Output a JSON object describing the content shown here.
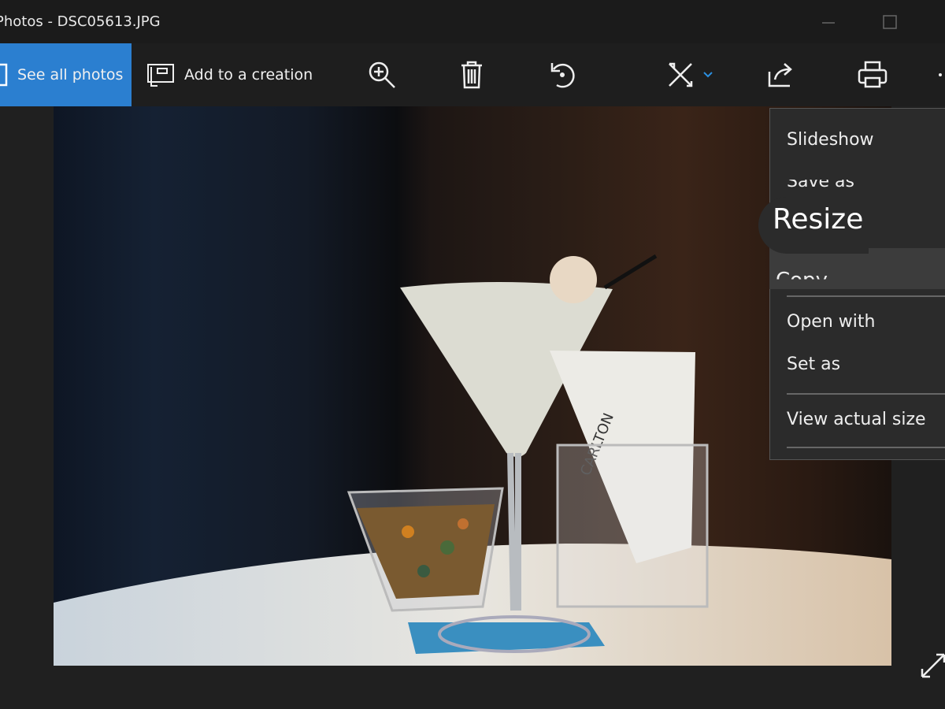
{
  "window": {
    "title": "Photos - DSC05613.JPG"
  },
  "toolbar": {
    "see_all": "See all photos",
    "add_creation": "Add to a creation",
    "icons": [
      "zoom-in-icon",
      "delete-icon",
      "rotate-icon",
      "edit-icon",
      "share-icon",
      "print-icon",
      "more-icon"
    ],
    "accent": "#2b7fd0"
  },
  "menu": {
    "items": [
      "Slideshow",
      "Save as",
      "Copy",
      "Open with",
      "Set as",
      "View actual size"
    ],
    "callout": "Resize"
  },
  "photo": {
    "label": "CARLTON"
  }
}
